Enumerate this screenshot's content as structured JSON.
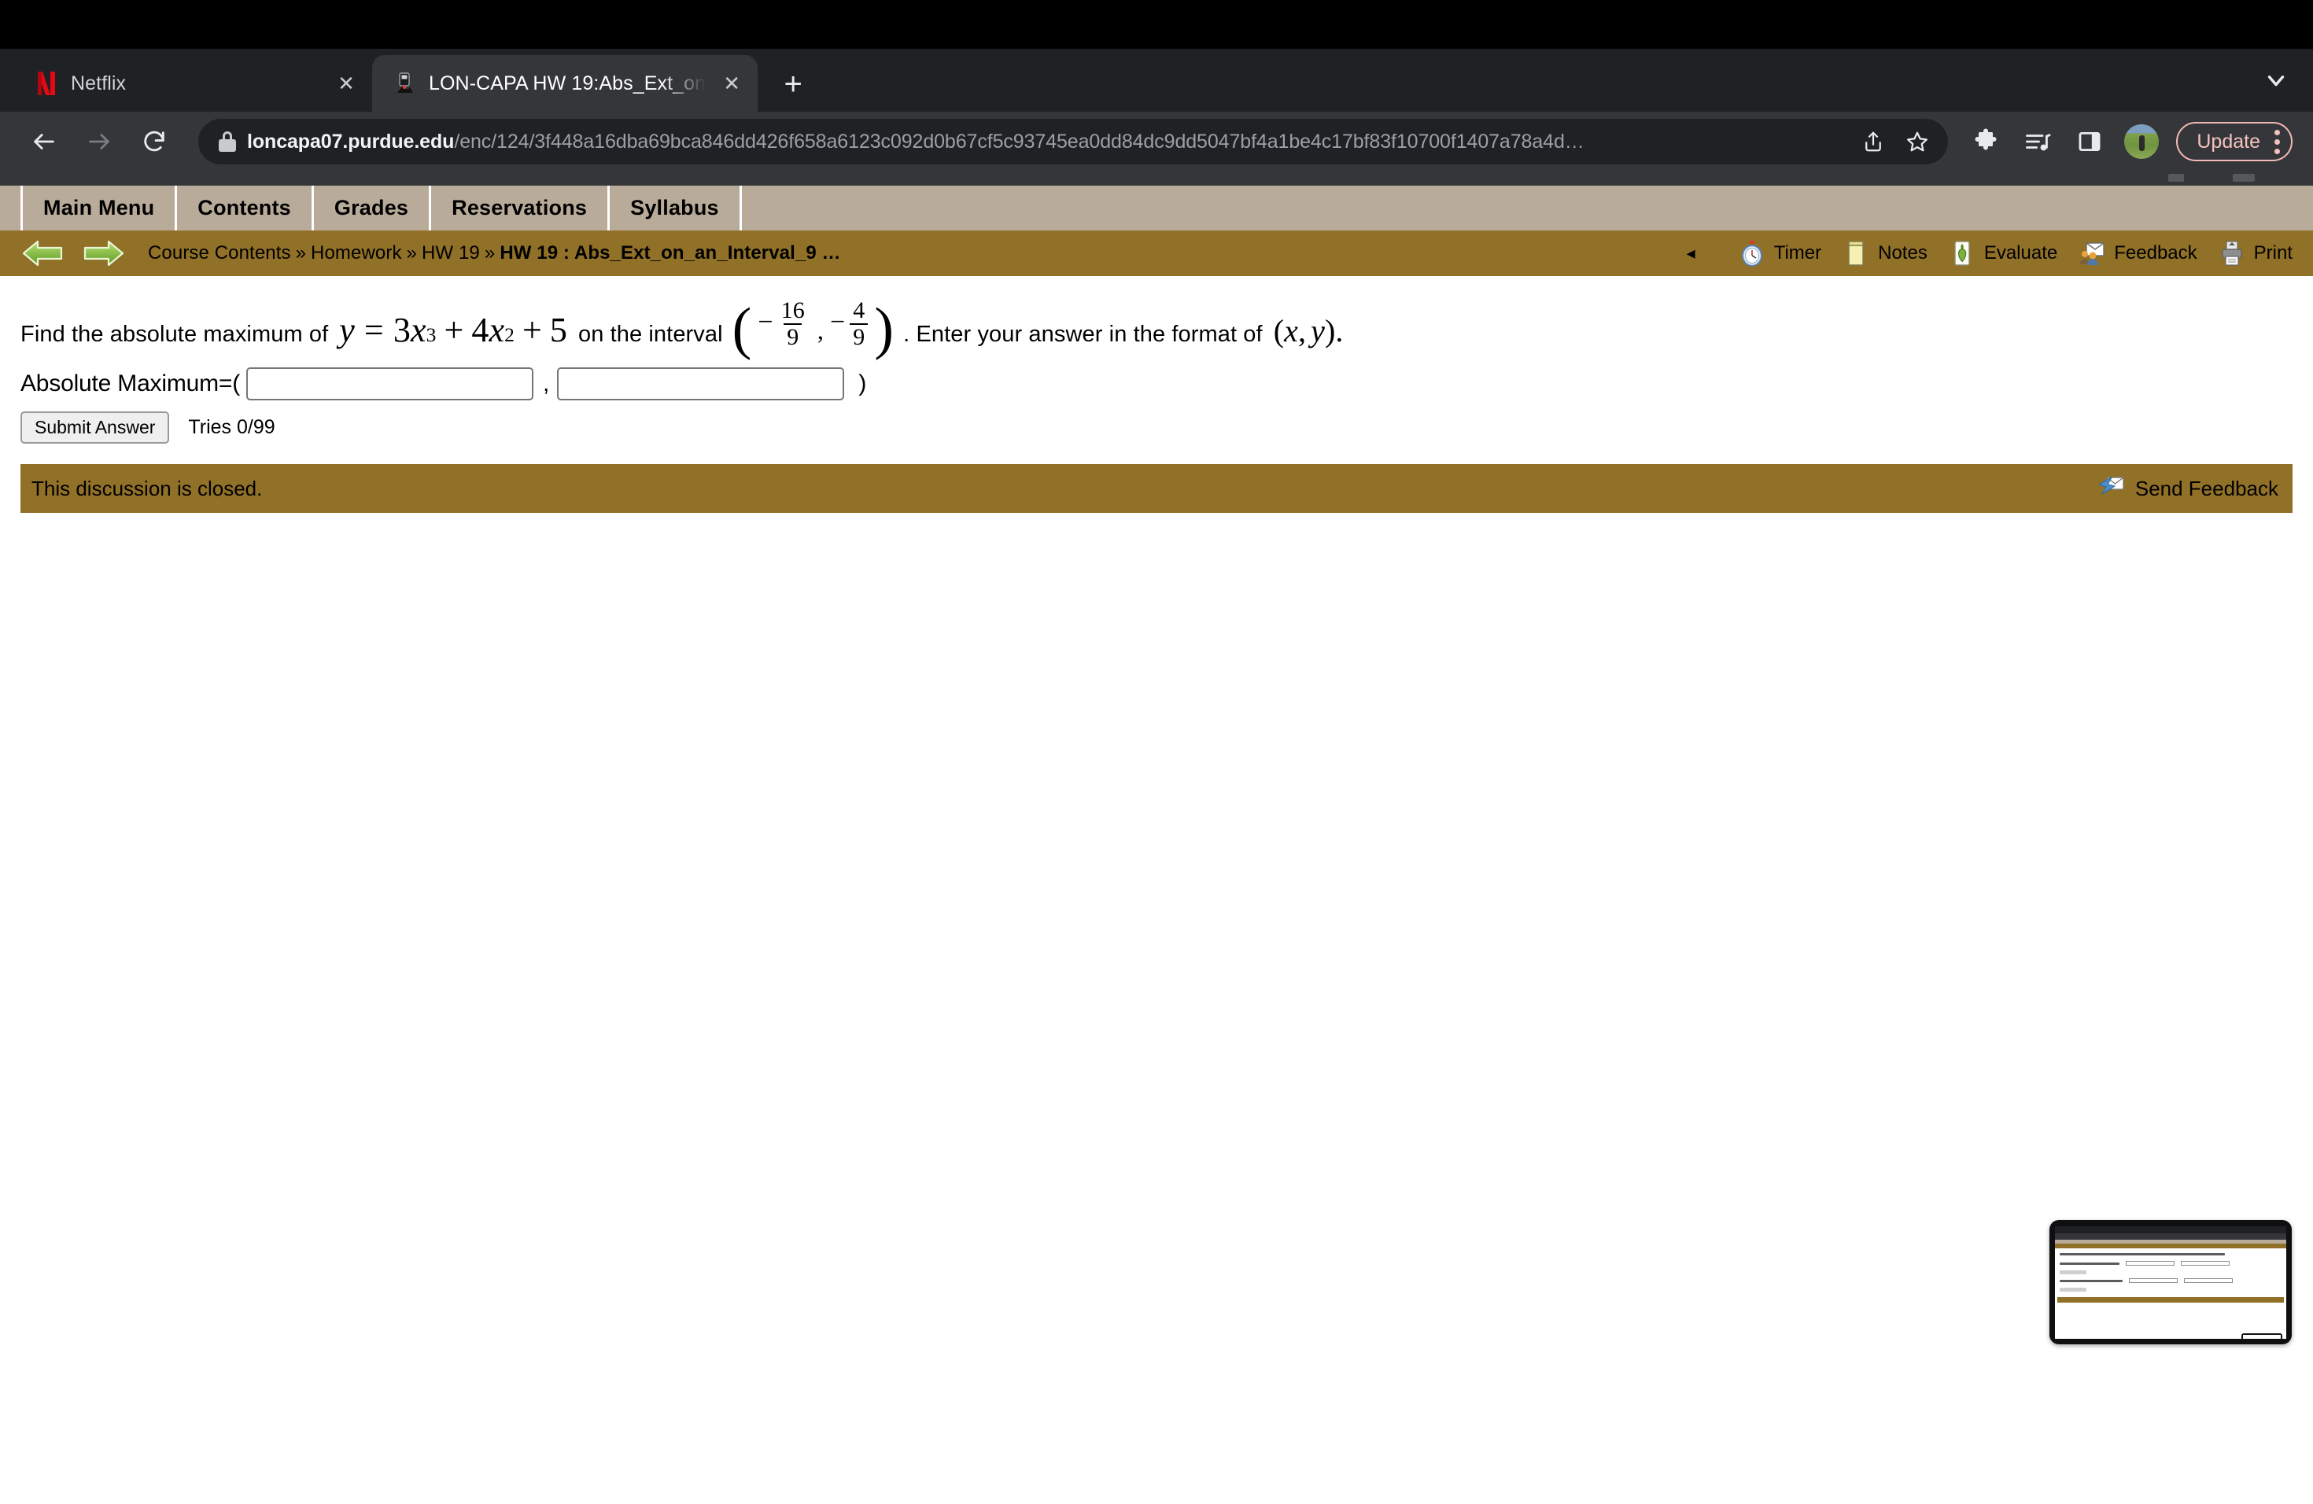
{
  "browser": {
    "tabs": [
      {
        "title": "Netflix",
        "favicon": "netflix-icon",
        "active": false,
        "close_label": "✕"
      },
      {
        "title": "LON-CAPA HW 19:Abs_Ext_on",
        "favicon": "loncapa-icon",
        "active": true,
        "close_label": "✕"
      }
    ],
    "new_tab_label": "+",
    "tabstrip_chevron": "chevron-down-icon",
    "nav": {
      "back": "←",
      "forward": "→",
      "reload": "↻"
    },
    "omnibox": {
      "secure_icon": "lock-icon",
      "host": "loncapa07.purdue.edu",
      "path": "/enc/124/3f448a16dba69bca846dd426f658a6123c092d0b67cf5c93745ea0dd84dc9dd5047bf4a1be4c17bf83f10700f1407a78a4d…",
      "share_icon": "share-icon",
      "bookmark_icon": "star-icon"
    },
    "toolbar_right": {
      "extensions_icon": "puzzle-icon",
      "reading_list_icon": "playlist-icon",
      "sidepanel_icon": "side-panel-icon",
      "avatar": "profile-avatar",
      "update_label": "Update",
      "menu_icon": "kebab-menu-icon"
    },
    "colors": {
      "tabstrip_bg": "#202124",
      "toolbar_bg": "#35363a",
      "omnibox_bg": "#202124",
      "update_accent": "#f5c2bf"
    }
  },
  "loncapa": {
    "menubar": [
      {
        "label": "Main Menu"
      },
      {
        "label": "Contents"
      },
      {
        "label": "Grades"
      },
      {
        "label": "Reservations"
      },
      {
        "label": "Syllabus"
      }
    ],
    "nav": {
      "back_icon": "green-left-arrow-icon",
      "forward_icon": "green-right-arrow-icon",
      "collapse_icon": "left-triangle-icon"
    },
    "breadcrumb": {
      "items": [
        "Course Contents",
        "Homework",
        "HW 19"
      ],
      "separator": "»",
      "current": "HW 19 : Abs_Ext_on_an_Interval_9 …"
    },
    "tools": [
      {
        "label": "Timer",
        "icon": "stopwatch-icon"
      },
      {
        "label": "Notes",
        "icon": "notepad-icon"
      },
      {
        "label": "Evaluate",
        "icon": "thumbs-up-icon"
      },
      {
        "label": "Feedback",
        "icon": "envelope-people-icon"
      },
      {
        "label": "Print",
        "icon": "printer-icon"
      }
    ],
    "colors": {
      "menubar_bg": "#b9ab99",
      "navbar_bg": "#917027"
    }
  },
  "problem": {
    "text_before": "Find the absolute maximum of",
    "equation": {
      "lhs": "y",
      "rel": "=",
      "t1_coef": "3",
      "t1_var": "x",
      "t1_pow": "3",
      "op1": "+",
      "t2_coef": "4",
      "t2_var": "x",
      "t2_pow": "2",
      "op2": "+",
      "t3": "5"
    },
    "text_mid": "on the interval",
    "interval": {
      "open": "(",
      "left_sign": "−",
      "left_num": "16",
      "left_den": "9",
      "comma": ",",
      "right_sign": "−",
      "right_num": "4",
      "right_den": "9",
      "close": ")"
    },
    "text_after": ". Enter your answer in the format of",
    "format": {
      "open": "(",
      "x": "x",
      "comma": ",",
      "y": "y",
      "close": ")",
      "period": "."
    }
  },
  "answer": {
    "label": "Absolute Maximum=(",
    "x_value": "",
    "y_value": "",
    "x_placeholder": "",
    "y_placeholder": "",
    "comma": ",",
    "close_paren": ")",
    "submit_label": "Submit Answer",
    "tries": "Tries 0/99"
  },
  "discussion": {
    "status": "This discussion is closed.",
    "feedback_label": "Send Feedback",
    "feedback_icon": "send-feedback-icon"
  },
  "thumbnail": {
    "name": "screen-share-preview"
  }
}
